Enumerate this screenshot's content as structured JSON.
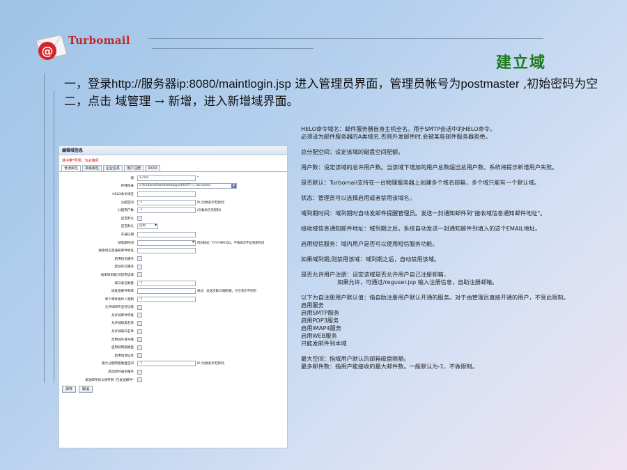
{
  "logo": {
    "text": "Turbomail",
    "icon": "at-envelope-icon"
  },
  "title": "建立域",
  "steps": [
    {
      "pre": "一，登录",
      "url": "http://",
      "mid": "服务器",
      "url2": "ip:8080/maintlogin.jsp",
      "post": " 进入管理员界面，管理员帐号为",
      "account": "postmaster",
      "post2": " ,初始密码为空"
    },
    {
      "text": "二，点击 域管理 → 新增，进入新增域界面。"
    }
  ],
  "panel": {
    "title": "编辑域信息",
    "note": "其中带*号项，为必填项",
    "tabs": [
      "普通属性",
      "高级属性",
      "企业信息",
      "用户注册",
      "XXXX"
    ],
    "rows": [
      {
        "label": "域",
        "type": "input",
        "value": "a.com",
        "suffix": "*"
      },
      {
        "label": "存储目录",
        "type": "select",
        "value": "c:\\turbomail\\web\\webapps\\ROOT\\ \\ \\ \\accounts"
      },
      {
        "label": "HELO命令域名",
        "type": "input",
        "value": ""
      },
      {
        "label": "分配空间",
        "type": "input",
        "value": "-1",
        "suffix": "M (负数表示无限制)"
      },
      {
        "label": "分配用户数",
        "type": "input",
        "value": "-1",
        "suffix": "(负数表示无限制)"
      },
      {
        "label": "是否默认",
        "type": "checkbox"
      },
      {
        "label": "是否默认",
        "type": "select-small",
        "value": "启用"
      },
      {
        "label": "开通日期",
        "type": "input",
        "value": ""
      },
      {
        "label": "域到期时间",
        "type": "select-date",
        "value": "",
        "suffix": "时间格式: YYYY-MM-DD，不填表示不设到期时间"
      },
      {
        "label": "接收域信息通知邮件地址",
        "type": "input",
        "value": ""
      },
      {
        "label": "启用短信服务",
        "type": "checkbox"
      },
      {
        "label": "启动彩信服务",
        "type": "checkbox"
      },
      {
        "label": "如果域到期,则禁用该域",
        "type": "checkbox"
      },
      {
        "label": "域日发信数量",
        "type": "input",
        "value": "-1"
      },
      {
        "label": "域发送邮件频率",
        "type": "input",
        "value": "",
        "suffix": "格式：发送次数/间隔秒数，为空表示不控制"
      },
      {
        "label": "单个邮件收件人限制",
        "type": "input",
        "value": "-1"
      },
      {
        "label": "允许域邮件监控功能",
        "type": "checkbox"
      },
      {
        "label": "允许域邮件审批",
        "type": "checkbox"
      },
      {
        "label": "允许域级黑名单",
        "type": "checkbox"
      },
      {
        "label": "允许域级白名单",
        "type": "checkbox"
      },
      {
        "label": "禁用域外发中继",
        "type": "checkbox"
      },
      {
        "label": "启用域网络硬盘",
        "type": "checkbox"
      },
      {
        "label": "启用域地址本",
        "type": "checkbox"
      },
      {
        "label": "最大分配网络硬盘空间",
        "type": "input",
        "value": "-1",
        "suffix": "M (负数表示无限制)"
      },
      {
        "label": "启动即时通讯服务",
        "type": "checkbox"
      },
      {
        "label": "发送邮件默认保存到 \"已发送邮件\"",
        "type": "checkbox"
      }
    ],
    "buttons": [
      "保存",
      "取消"
    ]
  },
  "descriptions": [
    {
      "text": "HELO命令域名：邮件服务器自身主机全名。用于SMTP会话中的HELO命令。"
    },
    {
      "text": "必须设为邮件服务器的A类域名,否则外发邮件时,会被某些邮件服务器拒绝。"
    },
    {
      "text": "总分配空间：设定该域的磁盘空间配额。",
      "gap": true
    },
    {
      "text": "用户数：设定该域的总许用户数。当该域下增加的用户总数超出总用户数，系统将提示新增用户失败。",
      "gap": true
    },
    {
      "text": "是否默认：Turbomail支持在一台物理服务器上创建多个域名邮箱，多个域只能有一个默认域。",
      "gap": true
    },
    {
      "text": "状态：管理员可以选择启用或者禁用该域名。",
      "gap": true
    },
    {
      "text": "域到期时间：域到期时自动发邮件提醒管理员。发送一封通知邮件到\"接收域信息通知邮件地址\"。",
      "gap": true
    },
    {
      "text": "接收域信息通知邮件地址：域到期之后，系统自动发送一封通知邮件到填入的这个EMAIL地址。",
      "gap": true
    },
    {
      "text": "启用短信服务：域内用户是否可以使用短信服务功能。",
      "gap": true
    },
    {
      "text": "如果域到期,则禁用该域：域到期之后，自动禁用该域。",
      "gap": true
    },
    {
      "text": "是否允许用户注册：设定该域是否允许用户自己注册邮箱，",
      "gap": true
    },
    {
      "text": "                    如果允许，可通过/reguser.jsp 输入注册信息，自助注册邮箱。"
    },
    {
      "text": "以下为自注册用户默认值：指自助注册用户默认开通的服务。对于由管理员直接开通的用户，不受此限制。",
      "gap": true
    },
    {
      "text": "启用服务"
    },
    {
      "text": "启用SMTP服务"
    },
    {
      "text": "启用POP3服务"
    },
    {
      "text": "启用IMAP4服务"
    },
    {
      "text": "启用WEB服务"
    },
    {
      "text": "只能发邮件到本域"
    },
    {
      "text": "最大空间：指域用户默认的邮箱磁盘限额。",
      "gap": true
    },
    {
      "text": "最多邮件数：指用户能接收的最大邮件数。一般默认为-1，不做限制。"
    }
  ],
  "colors": {
    "title": "#1a7a1a",
    "logo": "#c0282d",
    "required_note": "#dd0000"
  }
}
